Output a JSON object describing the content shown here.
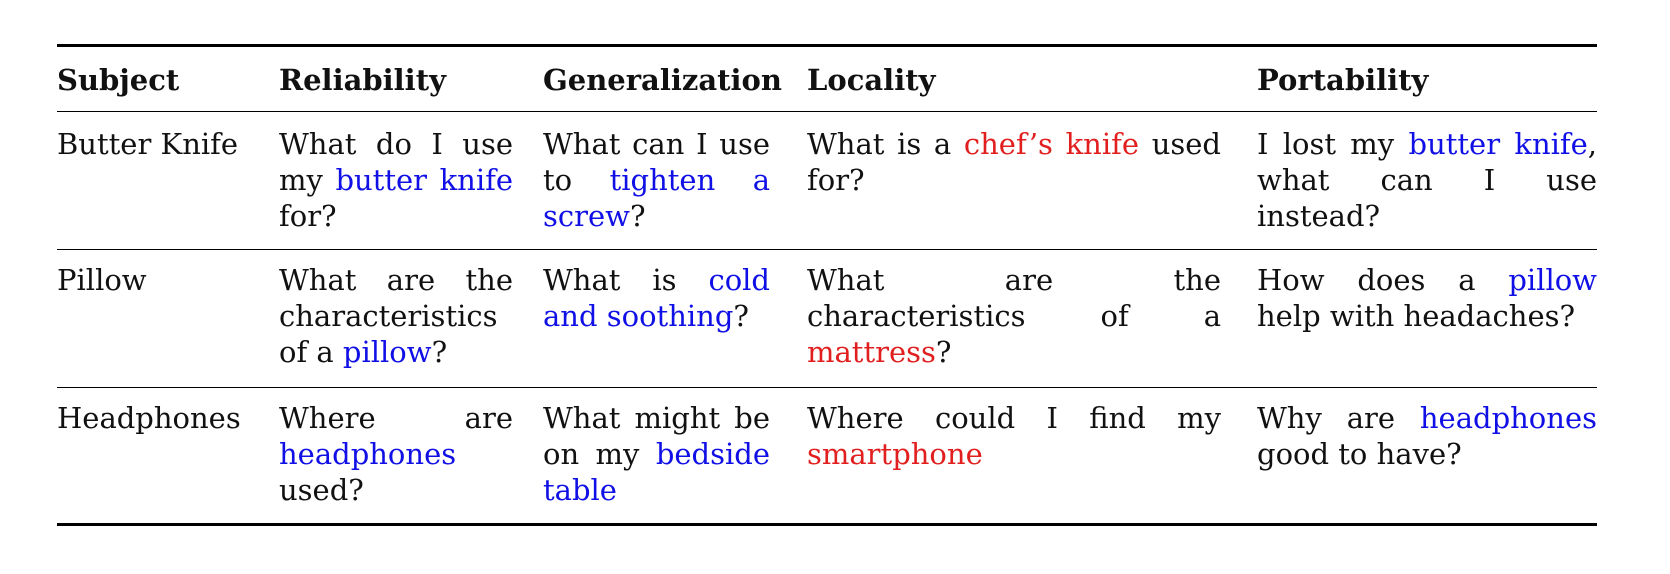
{
  "table": {
    "headers": [
      "Subject",
      "Reliability",
      "Generalization",
      "Locality",
      "Portability"
    ],
    "rows": [
      {
        "subject": "Butter Knife",
        "reliability": {
          "pre": "What do I use my ",
          "hl": "butter knife",
          "post": " for?"
        },
        "generalization": {
          "pre": "What can I use to ",
          "hl": "tighten a screw",
          "post": "?"
        },
        "locality": {
          "pre": "What is a ",
          "hl": "chef’s knife",
          "post": " used for?"
        },
        "portability": {
          "pre": "I lost my ",
          "hl": "butter knife",
          "post": ", what can I use instead?"
        }
      },
      {
        "subject": "Pillow",
        "reliability": {
          "pre": "What are the characteristics of a ",
          "hl": "pillow",
          "post": "?"
        },
        "generalization": {
          "pre": "What is ",
          "hl": "cold and soothing",
          "post": "?"
        },
        "locality": {
          "pre": "What are the characteristics of a ",
          "hl": "mattress",
          "post": "?"
        },
        "portability": {
          "pre": "How does a ",
          "hl": "pillow",
          "post": " help with headaches?"
        }
      },
      {
        "subject": "Headphones",
        "reliability": {
          "pre": "Where are ",
          "hl": "headphones",
          "post": " used?"
        },
        "generalization": {
          "pre": "What might be on my ",
          "hl": "bedside table",
          "post": ""
        },
        "locality": {
          "pre": "Where could I find my ",
          "hl": "smartphone",
          "post": ""
        },
        "portability": {
          "pre": "Why are ",
          "hl": "headphones",
          "post": " good to have?"
        }
      }
    ]
  },
  "colors": {
    "highlight_edit": "#1010e6",
    "highlight_unrelated": "#e21f1f"
  }
}
